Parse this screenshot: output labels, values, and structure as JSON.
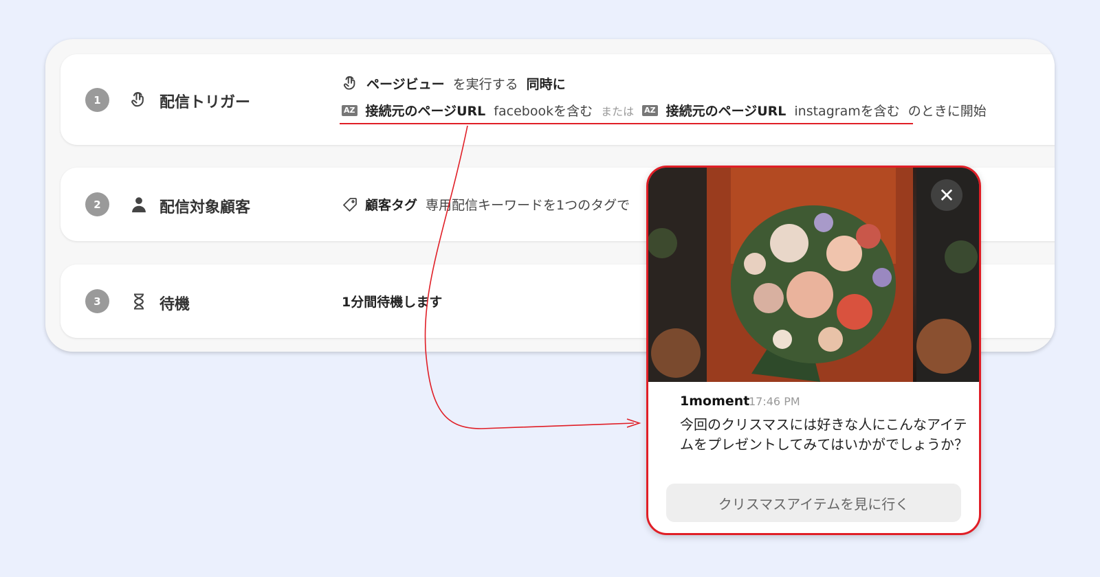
{
  "steps": [
    {
      "number": "1",
      "icon": "tap-hand-icon",
      "title": "配信トリガー",
      "line1": {
        "event": "ページビュー",
        "action": "を実行する",
        "suffix": "同時に"
      },
      "line2": {
        "badge": "AZ",
        "cond1_field": "接続元のページURL",
        "cond1_value": "facebookを含む",
        "or": "または",
        "cond2_field": "接続元のページURL",
        "cond2_value": "instagramを含む",
        "tail": "のときに開始"
      }
    },
    {
      "number": "2",
      "icon": "person-icon",
      "title": "配信対象顧客",
      "tag_label": "顧客タグ",
      "description": "専用配信キーワードを1つのタグで"
    },
    {
      "number": "3",
      "icon": "hourglass-icon",
      "title": "待機",
      "description": "1分間待機します"
    }
  ],
  "popup": {
    "sender": "1moment",
    "time": "17:46 PM",
    "message": "今回のクリスマスには好きな人にこんなアイテムをプレゼントしてみてはいかがでしょうか？",
    "button_label": "クリスマスアイテムを見に行く",
    "close_icon": "close-icon"
  },
  "colors": {
    "background": "#ebf0fd",
    "accent_red": "#e01e26",
    "step_number_bg": "#9a9a9a"
  }
}
